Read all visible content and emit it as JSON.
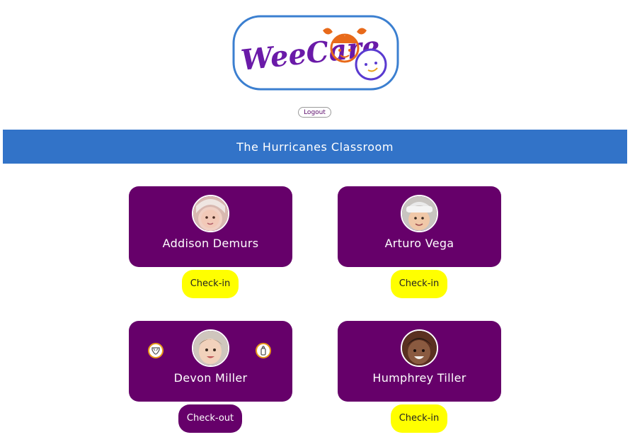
{
  "logo": {
    "text": "WeeCare",
    "colors": {
      "text": "#6a1aa8",
      "border": "#3b7fd0",
      "girl": "#e86a1a",
      "boy": "#5a3ad0"
    }
  },
  "header": {
    "logout_label": "Logout"
  },
  "classroom": {
    "title": "The Hurricanes Classroom",
    "banner_color": "#3273c8"
  },
  "children": [
    {
      "name": "Addison Demurs",
      "action_label": "Check-in",
      "action_type": "check-in",
      "avatar_icon": "child-photo",
      "status_icons": []
    },
    {
      "name": "Arturo Vega",
      "action_label": "Check-in",
      "action_type": "check-in",
      "avatar_icon": "child-photo",
      "status_icons": []
    },
    {
      "name": "Devon Miller",
      "action_label": "Check-out",
      "action_type": "check-out",
      "avatar_icon": "child-photo",
      "status_icons": [
        "diaper-icon",
        "bottle-icon"
      ]
    },
    {
      "name": "Humphrey Tiller",
      "action_label": "Check-in",
      "action_type": "check-in",
      "avatar_icon": "child-photo",
      "status_icons": []
    }
  ],
  "colors": {
    "card": "#66006a",
    "check_in": "#ffff00",
    "check_out": "#66006a",
    "status_icon_ring": "#e89a1a"
  }
}
